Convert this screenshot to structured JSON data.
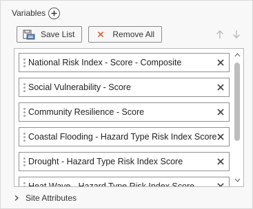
{
  "header": {
    "title": "Variables"
  },
  "toolbar": {
    "save_label": "Save List",
    "remove_all_label": "Remove All"
  },
  "variables": [
    {
      "label": "National Risk Index - Score - Composite"
    },
    {
      "label": "Social Vulnerability - Score"
    },
    {
      "label": "Community Resilience - Score"
    },
    {
      "label": "Coastal Flooding - Hazard Type Risk Index Score"
    },
    {
      "label": "Drought - Hazard Type Risk Index Score"
    },
    {
      "label": "Heat Wave - Hazard Type Risk Index Score"
    }
  ],
  "sections": [
    {
      "label": "Site Attributes",
      "expanded": false
    }
  ],
  "colors": {
    "remove_accent": "#e05a2b",
    "save_icon": "#5a7fb5"
  }
}
